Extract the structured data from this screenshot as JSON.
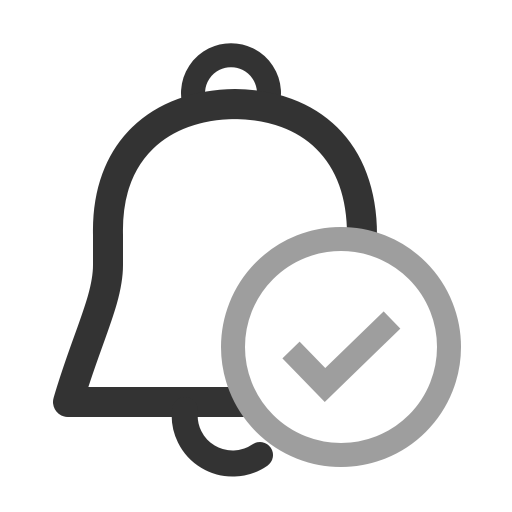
{
  "icon": {
    "name": "notification-bell-check-icon",
    "parts": {
      "bell": "bell-icon",
      "badge": "check-circle-icon",
      "check": "checkmark-icon"
    }
  },
  "colors": {
    "background": "#ffffff",
    "bell_stroke": "#333333",
    "badge_stroke": "#9e9e9e",
    "badge_fill": "#ffffff"
  }
}
